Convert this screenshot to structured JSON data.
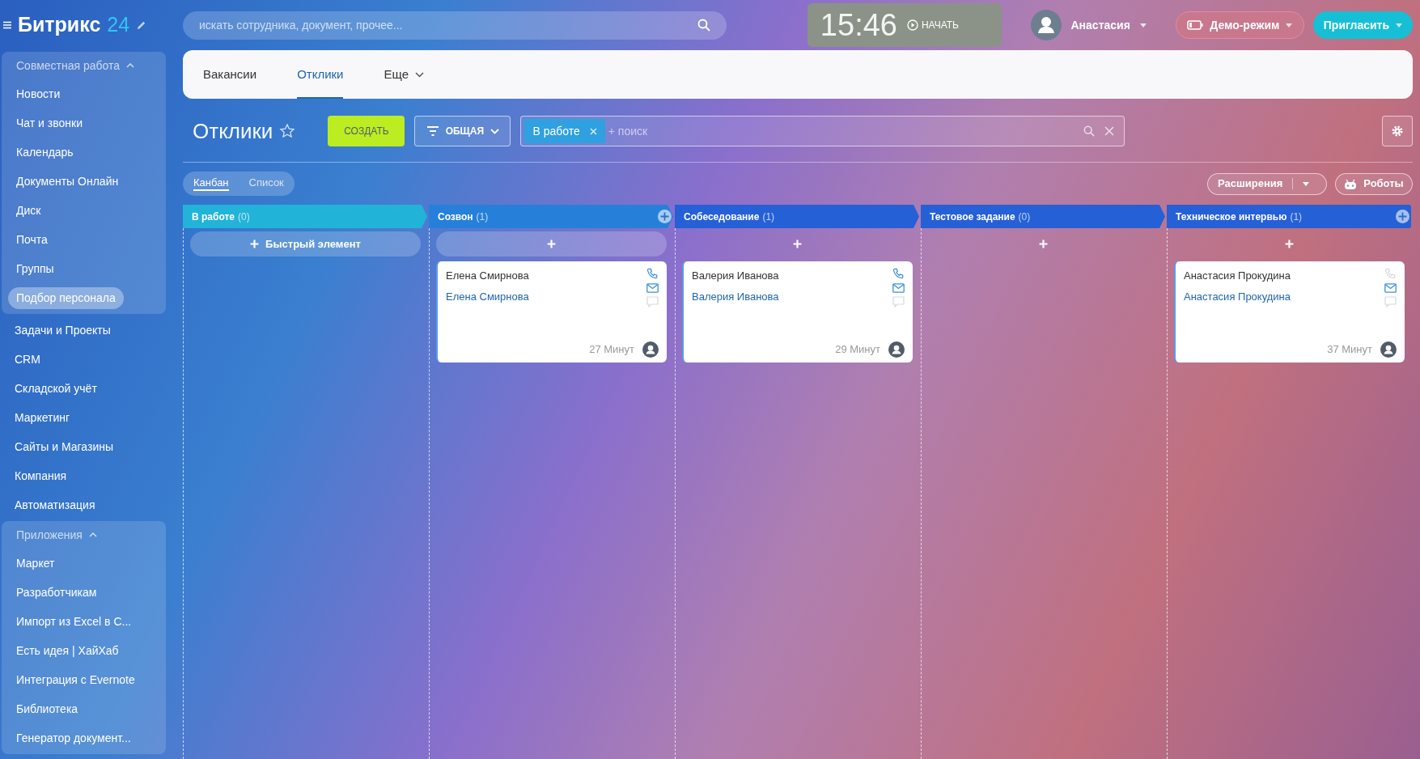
{
  "logo": {
    "text": "Битрикс",
    "number": "24"
  },
  "search": {
    "placeholder": "искать сотрудника, документ, прочее..."
  },
  "clock": {
    "time": "15:46",
    "action": "НАЧАТЬ"
  },
  "user": {
    "name": "Анастасия"
  },
  "demo_button": "Демо-режим",
  "invite_button": "Пригласить",
  "sidebar": [
    {
      "kind": "group",
      "title": "Совместная работа",
      "expanded": true,
      "items": [
        {
          "label": "Новости",
          "selected": false
        },
        {
          "label": "Чат и звонки",
          "selected": false
        },
        {
          "label": "Календарь",
          "selected": false
        },
        {
          "label": "Документы Онлайн",
          "selected": false
        },
        {
          "label": "Диск",
          "selected": false
        },
        {
          "label": "Почта",
          "selected": false
        },
        {
          "label": "Группы",
          "selected": false
        },
        {
          "label": "Подбор персонала",
          "selected": true
        }
      ]
    },
    {
      "kind": "item",
      "label": "Задачи и Проекты",
      "selected": false
    },
    {
      "kind": "item",
      "label": "CRM",
      "selected": false
    },
    {
      "kind": "item",
      "label": "Складской учёт",
      "selected": false
    },
    {
      "kind": "item",
      "label": "Маркетинг",
      "selected": false
    },
    {
      "kind": "item",
      "label": "Сайты и Магазины",
      "selected": false
    },
    {
      "kind": "item",
      "label": "Компания",
      "selected": false
    },
    {
      "kind": "item",
      "label": "Автоматизация",
      "selected": false
    },
    {
      "kind": "group",
      "title": "Приложения",
      "expanded": true,
      "items": [
        {
          "label": "Маркет",
          "selected": false
        },
        {
          "label": "Разработчикам",
          "selected": false
        },
        {
          "label": "Импорт из Excel в С...",
          "selected": false
        },
        {
          "label": "Есть идея | ХайХаб",
          "selected": false
        },
        {
          "label": "Интеграция с Evernote",
          "selected": false
        },
        {
          "label": "Библиотека",
          "selected": false
        },
        {
          "label": "Генератор документ...",
          "selected": false
        }
      ]
    }
  ],
  "tabs": [
    {
      "label": "Вакансии",
      "selected": false,
      "kind": "tab"
    },
    {
      "label": "Отклики",
      "selected": true,
      "kind": "tab"
    },
    {
      "label": "Еще",
      "selected": false,
      "kind": "more"
    }
  ],
  "page_title": "Отклики",
  "create_button": "СОЗДАТЬ",
  "filter_button": "ОБЩАЯ",
  "filter": {
    "tag": "В работе",
    "placeholder": "+ поиск"
  },
  "views": [
    {
      "label": "Канбан",
      "selected": true
    },
    {
      "label": "Список",
      "selected": false
    }
  ],
  "extensions_button": "Расширения",
  "robots_button": "Роботы",
  "columns": [
    {
      "title": "В работе",
      "count": "(0)",
      "color": "#22b3d8",
      "add_icon": false,
      "add_bar": {
        "label": "Быстрый элемент",
        "highlighted": true
      }
    },
    {
      "title": "Созвон",
      "count": "(1)",
      "color": "#2680d9",
      "add_icon": true,
      "add_bar": {
        "highlighted": true
      },
      "cards": [
        {
          "title": "Елена Смирнова",
          "contact": "Елена Смирнова",
          "time": "27 Минут",
          "phone_enabled": true
        }
      ]
    },
    {
      "title": "Собеседование",
      "count": "(1)",
      "color": "#2560d6",
      "add_icon": false,
      "add_bar": {
        "highlighted": false
      },
      "cards": [
        {
          "title": "Валерия Иванова",
          "contact": "Валерия Иванова",
          "time": "29 Минут",
          "phone_enabled": true
        }
      ]
    },
    {
      "title": "Тестовое задание",
      "count": "(0)",
      "color": "#2560d6",
      "add_icon": false,
      "add_bar": {
        "highlighted": false
      }
    },
    {
      "title": "Техническое интервью",
      "count": "(1)",
      "color": "#2560d6",
      "add_icon": true,
      "add_bar": {
        "highlighted": false
      },
      "cards": [
        {
          "title": "Анастасия Прокудина",
          "contact": "Анастасия Прокудина",
          "time": "37 Минут",
          "phone_enabled": false
        }
      ]
    }
  ]
}
